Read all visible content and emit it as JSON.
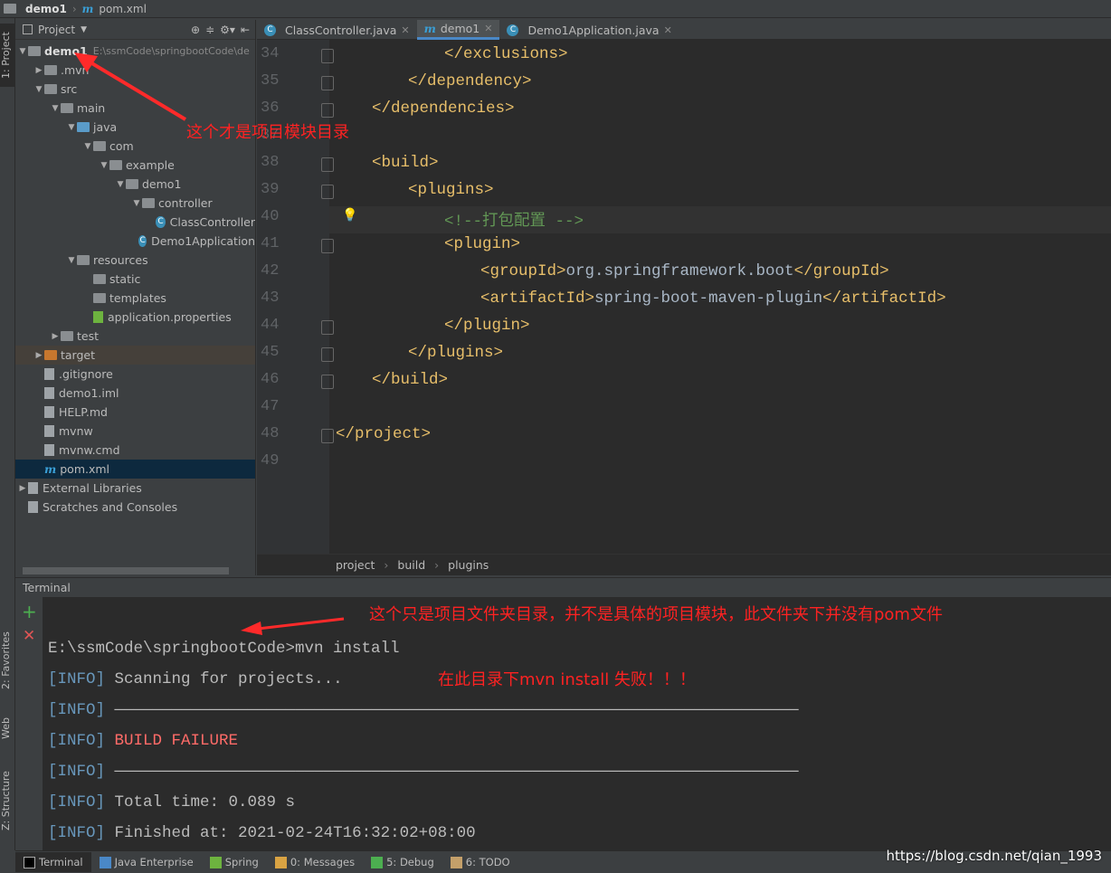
{
  "breadcrumb": {
    "project": "demo1",
    "file": "pom.xml",
    "file_icon": "m"
  },
  "left_strip": {
    "project": "1: Project",
    "favorites": "2: Favorites",
    "web": "Web",
    "structure": "Z: Structure"
  },
  "project_panel": {
    "title": "Project",
    "tree": [
      {
        "label": "demo1",
        "path": "E:\\ssmCode\\springbootCode\\de",
        "depth": 0,
        "arrow": "▼",
        "icon": "module"
      },
      {
        "label": ".mvn",
        "depth": 1,
        "arrow": "▶",
        "icon": "folder"
      },
      {
        "label": "src",
        "depth": 1,
        "arrow": "▼",
        "icon": "folder"
      },
      {
        "label": "main",
        "depth": 2,
        "arrow": "▼",
        "icon": "folder"
      },
      {
        "label": "java",
        "depth": 3,
        "arrow": "▼",
        "icon": "folder-blue"
      },
      {
        "label": "com",
        "depth": 4,
        "arrow": "▼",
        "icon": "package"
      },
      {
        "label": "example",
        "depth": 5,
        "arrow": "▼",
        "icon": "package"
      },
      {
        "label": "demo1",
        "depth": 6,
        "arrow": "▼",
        "icon": "package"
      },
      {
        "label": "controller",
        "depth": 7,
        "arrow": "▼",
        "icon": "package"
      },
      {
        "label": "ClassController",
        "depth": 8,
        "arrow": "",
        "icon": "class"
      },
      {
        "label": "Demo1Application",
        "depth": 7,
        "arrow": "",
        "icon": "spring-class"
      },
      {
        "label": "resources",
        "depth": 3,
        "arrow": "▼",
        "icon": "folder"
      },
      {
        "label": "static",
        "depth": 4,
        "arrow": "",
        "icon": "folder"
      },
      {
        "label": "templates",
        "depth": 4,
        "arrow": "",
        "icon": "folder"
      },
      {
        "label": "application.properties",
        "depth": 4,
        "arrow": "",
        "icon": "spring-leaf"
      },
      {
        "label": "test",
        "depth": 2,
        "arrow": "▶",
        "icon": "folder"
      },
      {
        "label": "target",
        "depth": 1,
        "arrow": "▶",
        "icon": "folder-orange"
      },
      {
        "label": ".gitignore",
        "depth": 1,
        "arrow": "",
        "icon": "file"
      },
      {
        "label": "demo1.iml",
        "depth": 1,
        "arrow": "",
        "icon": "file"
      },
      {
        "label": "HELP.md",
        "depth": 1,
        "arrow": "",
        "icon": "file"
      },
      {
        "label": "mvnw",
        "depth": 1,
        "arrow": "",
        "icon": "file"
      },
      {
        "label": "mvnw.cmd",
        "depth": 1,
        "arrow": "",
        "icon": "file"
      },
      {
        "label": "pom.xml",
        "depth": 1,
        "arrow": "",
        "icon": "maven",
        "selected": true
      },
      {
        "label": "External Libraries",
        "depth": 0,
        "arrow": "▶",
        "icon": "library"
      },
      {
        "label": "Scratches and Consoles",
        "depth": 0,
        "arrow": "",
        "icon": "scratch"
      }
    ]
  },
  "editor": {
    "tabs": [
      {
        "label": "ClassController.java",
        "icon": "class"
      },
      {
        "label": "demo1",
        "icon": "maven",
        "active": true
      },
      {
        "label": "Demo1Application.java",
        "icon": "spring-class"
      }
    ],
    "lines": [
      {
        "n": "34",
        "indent": 3,
        "text": "</exclusions>"
      },
      {
        "n": "35",
        "indent": 2,
        "text": "</dependency>"
      },
      {
        "n": "36",
        "indent": 1,
        "text": "</dependencies>"
      },
      {
        "n": "37",
        "indent": 0,
        "text": ""
      },
      {
        "n": "38",
        "indent": 1,
        "text": "<build>"
      },
      {
        "n": "39",
        "indent": 2,
        "text": "<plugins>"
      },
      {
        "n": "40",
        "indent": 3,
        "text": "<!--打包配置 -->",
        "comment": true
      },
      {
        "n": "41",
        "indent": 3,
        "text": "<plugin>"
      },
      {
        "n": "42",
        "indent": 4,
        "open": "<groupId>",
        "value": "org.springframework.boot",
        "close": "</groupId>"
      },
      {
        "n": "43",
        "indent": 4,
        "open": "<artifactId>",
        "value": "spring-boot-maven-plugin",
        "close": "</artifactId>"
      },
      {
        "n": "44",
        "indent": 3,
        "text": "</plugin>"
      },
      {
        "n": "45",
        "indent": 2,
        "text": "</plugins>"
      },
      {
        "n": "46",
        "indent": 1,
        "text": "</build>"
      },
      {
        "n": "47",
        "indent": 0,
        "text": ""
      },
      {
        "n": "48",
        "indent": 0,
        "text": "</project>"
      },
      {
        "n": "49",
        "indent": 0,
        "text": ""
      }
    ],
    "crumbs": [
      "project",
      "build",
      "plugins"
    ]
  },
  "terminal": {
    "title": "Terminal",
    "lines": [
      {
        "prefix": "",
        "text": "E:\\ssmCode\\springbootCode>mvn install"
      },
      {
        "prefix": "[INFO]",
        "text": "Scanning for projects..."
      },
      {
        "prefix": "[INFO]",
        "text": "————————————————————————————————————————————————————————————————————————"
      },
      {
        "prefix": "[INFO]",
        "text": "BUILD FAILURE",
        "error": true
      },
      {
        "prefix": "[INFO]",
        "text": "————————————————————————————————————————————————————————————————————————"
      },
      {
        "prefix": "[INFO]",
        "text": "Total time: 0.089 s"
      },
      {
        "prefix": "[INFO]",
        "text": "Finished at: 2021-02-24T16:32:02+08:00"
      }
    ]
  },
  "bottom_tabs": [
    "Terminal",
    "Java Enterprise",
    "Spring",
    "0: Messages",
    "5: Debug",
    "6: TODO"
  ],
  "annotations": {
    "module_note": "这个才是项目模块目录",
    "folder_note": "这个只是项目文件夹目录，并不是具体的项目模块，此文件夹下并没有pom文件",
    "fail_note": "在此目录下mvn install 失败！！！"
  },
  "watermark": "https://blog.csdn.net/qian_1993",
  "colors": {
    "tag": "#e8bf6a",
    "text": "#a9b7c6",
    "comment": "#629755",
    "annotation": "#ff2222",
    "error": "#ff6b68"
  }
}
